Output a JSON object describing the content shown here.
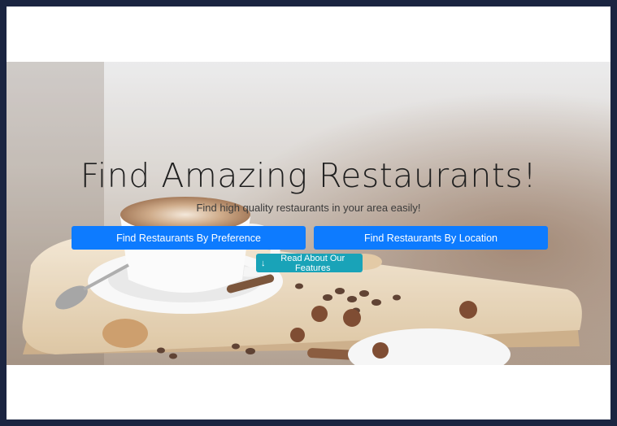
{
  "hero": {
    "title": "Find Amazing Restaurants!",
    "subtitle": "Find high quality restaurants in your area easily!",
    "buttons": {
      "preference": "Find Restaurants By Preference",
      "location": "Find Restaurants By Location",
      "features": "Read About Our Features",
      "features_icon": "↓"
    }
  },
  "colors": {
    "frame": "#1b2541",
    "primary": "#0d7bff",
    "info": "#19a3b8"
  }
}
